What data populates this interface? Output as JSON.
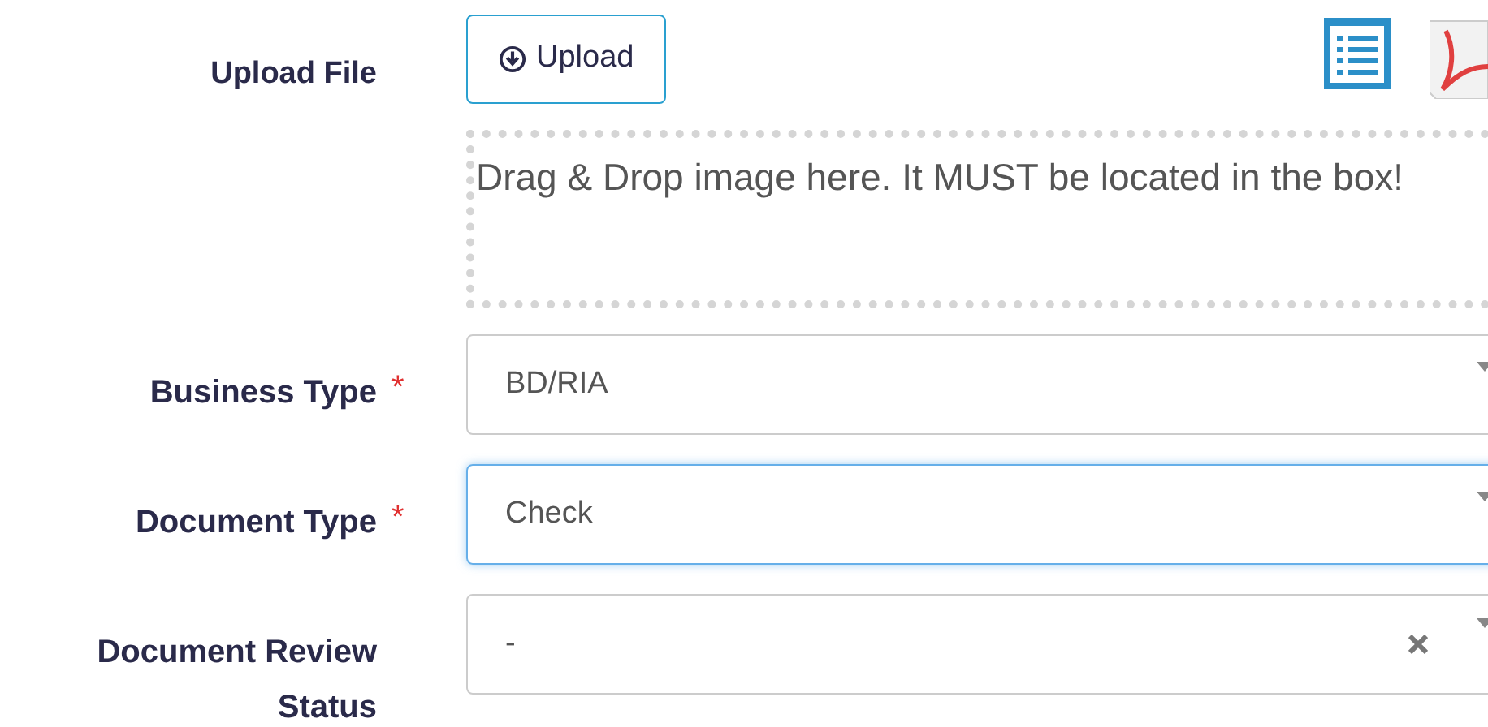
{
  "upload": {
    "label": "Upload File",
    "button": "Upload",
    "dropzone": "Drag & Drop image here. It MUST be located in the box!"
  },
  "fields": [
    {
      "label": "Business Type",
      "required_mark": "*",
      "value": "BD/RIA",
      "focused": false,
      "clearable": false
    },
    {
      "label": "Document Type",
      "required_mark": "*",
      "value": "Check",
      "focused": true,
      "clearable": false
    },
    {
      "label": "Document Review Status",
      "value": "-",
      "focused": false,
      "clearable": true
    }
  ]
}
